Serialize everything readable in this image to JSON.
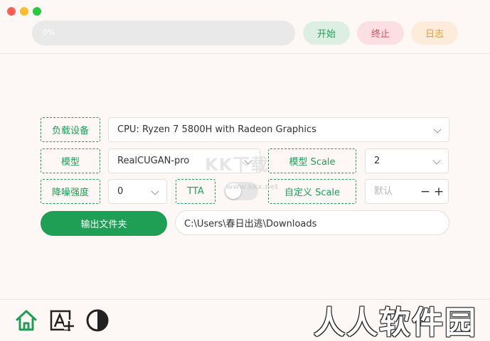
{
  "top_bar": {
    "progress": {
      "text": "0%",
      "value": 0
    },
    "start_label": "开始",
    "stop_label": "终止",
    "log_label": "日志"
  },
  "form": {
    "device": {
      "label": "负载设备",
      "value": "CPU: Ryzen 7 5800H with Radeon Graphics"
    },
    "model": {
      "label": "模型",
      "value": "RealCUGAN-pro"
    },
    "model_scale": {
      "label": "模型 Scale",
      "value": "2"
    },
    "denoise": {
      "label": "降噪强度",
      "value": "0"
    },
    "tta": {
      "label": "TTA",
      "enabled": false
    },
    "custom_scale": {
      "label": "自定义 Scale",
      "placeholder": "默认",
      "minus": "−",
      "plus": "+"
    },
    "output": {
      "button_label": "输出文件夹",
      "path": "C:\\Users\\春日出逃\\Downloads"
    }
  },
  "bottom_nav": {
    "icons": [
      "home-icon",
      "image-text-add-icon",
      "theme-contrast-icon"
    ],
    "accent": "#1f9e55"
  },
  "watermark": {
    "main": "KK下载",
    "url": "www.kkx.net",
    "corner": "人人软件园"
  },
  "colors": {
    "accent": "#1f9e55",
    "stop": "#e04b5a",
    "log": "#e59a3e",
    "background": "#fdf8f6"
  }
}
